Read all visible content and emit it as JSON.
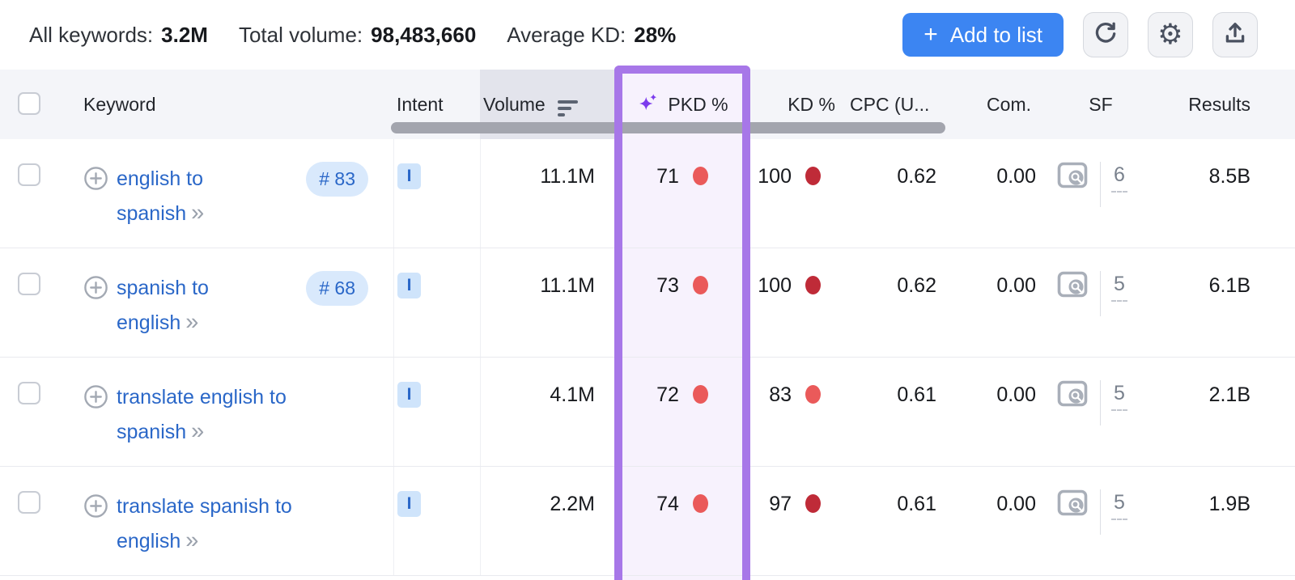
{
  "toolbar": {
    "stats": [
      {
        "label": "All keywords:",
        "value": "3.2M"
      },
      {
        "label": "Total volume:",
        "value": "98,483,660"
      },
      {
        "label": "Average KD:",
        "value": "28%"
      }
    ],
    "add_to_list": {
      "plus": "+",
      "label": "Add to list"
    },
    "icon_buttons": [
      "refresh-icon",
      "settings-icon",
      "export-icon"
    ]
  },
  "table": {
    "header": {
      "keyword": "Keyword",
      "intent": "Intent",
      "volume": "Volume",
      "pkd": "PKD %",
      "kd": "KD %",
      "cpc": "CPC (U...",
      "com": "Com.",
      "sf": "SF",
      "results": "Results"
    },
    "rows": [
      {
        "keyword": "english to spanish",
        "keyword_line1": "english to",
        "keyword_line2": "spanish",
        "rank": "# 83",
        "intent": "I",
        "volume": "11.1M",
        "pkd": "71",
        "pkd_dot": "dot_red",
        "kd": "100",
        "kd_dot": "dot_dark_red",
        "cpc": "0.62",
        "com": "0.00",
        "sf": "6",
        "results": "8.5B"
      },
      {
        "keyword": "spanish to english",
        "keyword_line1": "spanish to",
        "keyword_line2": "english",
        "rank": "# 68",
        "intent": "I",
        "volume": "11.1M",
        "pkd": "73",
        "pkd_dot": "dot_red",
        "kd": "100",
        "kd_dot": "dot_dark_red",
        "cpc": "0.62",
        "com": "0.00",
        "sf": "5",
        "results": "6.1B"
      },
      {
        "keyword": "translate english to spanish",
        "keyword_line1": "translate english to",
        "keyword_line2": "spanish",
        "rank": null,
        "intent": "I",
        "volume": "4.1M",
        "pkd": "72",
        "pkd_dot": "dot_red",
        "kd": "83",
        "kd_dot": "dot_red",
        "cpc": "0.61",
        "com": "0.00",
        "sf": "5",
        "results": "2.1B"
      },
      {
        "keyword": "translate spanish to english",
        "keyword_line1": "translate spanish to",
        "keyword_line2": "english",
        "rank": null,
        "intent": "I",
        "volume": "2.2M",
        "pkd": "74",
        "pkd_dot": "dot_red",
        "kd": "97",
        "kd_dot": "dot_dark_red",
        "cpc": "0.61",
        "com": "0.00",
        "sf": "5",
        "results": "1.9B"
      }
    ]
  },
  "icons": {
    "chevron_double": "»",
    "gear_glyph": "⚙"
  },
  "colors": {
    "accent_blue": "#3c85f2",
    "link_blue": "#2a67c8",
    "purple_border": "#a777e8",
    "purple_bg": "#f7f2fd",
    "dot_red": "#ea5a5a",
    "dot_dark_red": "#bf2b38",
    "badge_bg": "#d9e9fc",
    "intent_bg": "#cfe4fb",
    "header_bg": "#f4f5f9",
    "volume_header_bg": "#e3e4ec"
  }
}
